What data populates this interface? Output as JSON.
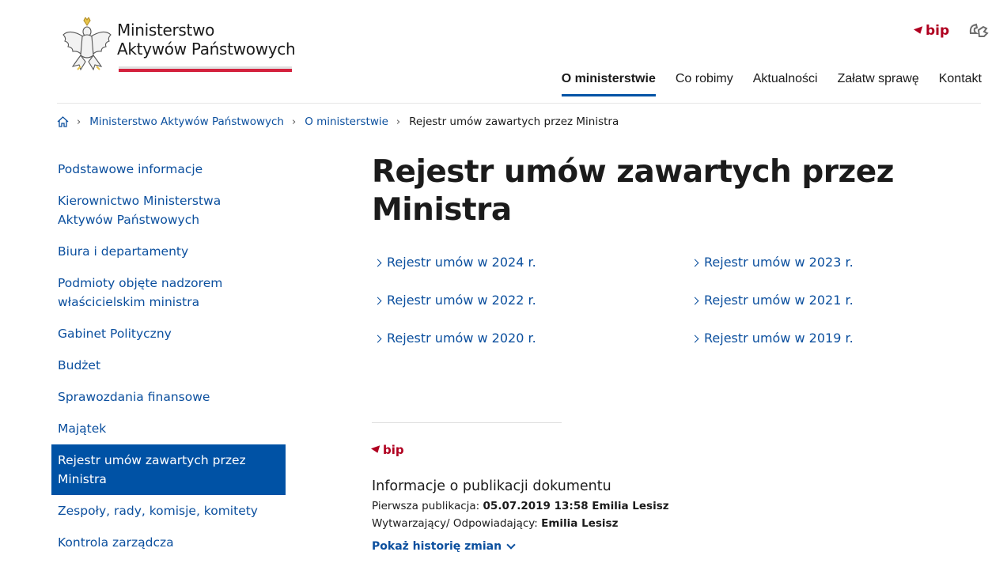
{
  "header": {
    "logo_line1": "Ministerstwo",
    "logo_line2": "Aktywów Państwowych",
    "bip_label": "bip",
    "sign_language_icon": "sign-language-icon"
  },
  "nav": {
    "items": [
      {
        "label": "O ministerstwie",
        "active": true
      },
      {
        "label": "Co robimy"
      },
      {
        "label": "Aktualności"
      },
      {
        "label": "Załatw sprawę"
      },
      {
        "label": "Kontakt"
      }
    ]
  },
  "breadcrumb": {
    "home_icon": "home-icon",
    "items": [
      "Ministerstwo Aktywów Państwowych",
      "O ministerstwie"
    ],
    "current": "Rejestr umów zawartych przez Ministra"
  },
  "sidebar": {
    "items": [
      {
        "label": "Podstawowe informacje"
      },
      {
        "label": "Kierownictwo Ministerstwa Aktywów Państwowych"
      },
      {
        "label": "Biura i departamenty"
      },
      {
        "label": "Podmioty objęte nadzorem właścicielskim ministra"
      },
      {
        "label": "Gabinet Polityczny"
      },
      {
        "label": "Budżet"
      },
      {
        "label": "Sprawozdania finansowe"
      },
      {
        "label": "Majątek"
      },
      {
        "label": "Rejestr umów zawartych przez Ministra",
        "active": true
      },
      {
        "label": "Zespoły, rady, komisje, komitety"
      },
      {
        "label": "Kontrola zarządcza"
      }
    ]
  },
  "main": {
    "title": "Rejestr umów zawartych przez Ministra",
    "links": [
      "Rejestr umów w 2024 r.",
      "Rejestr umów w 2023 r.",
      "Rejestr umów w 2022 r.",
      "Rejestr umów w 2021 r.",
      "Rejestr umów w 2020 r.",
      "Rejestr umów w 2019 r."
    ]
  },
  "publication": {
    "bip_label": "bip",
    "title": "Informacje o publikacji dokumentu",
    "first_pub_label": "Pierwsza publikacja:",
    "first_pub_value": "05.07.2019 13:58 Emilia Lesisz",
    "author_label": "Wytwarzający/ Odpowiadający:",
    "author_value": "Emilia Lesisz",
    "history_label": "Pokaż historię zmian"
  },
  "colors": {
    "accent": "#0052a5",
    "link": "#0b4f9e",
    "bip_red": "#b00020",
    "flag_red": "#d4213d"
  }
}
